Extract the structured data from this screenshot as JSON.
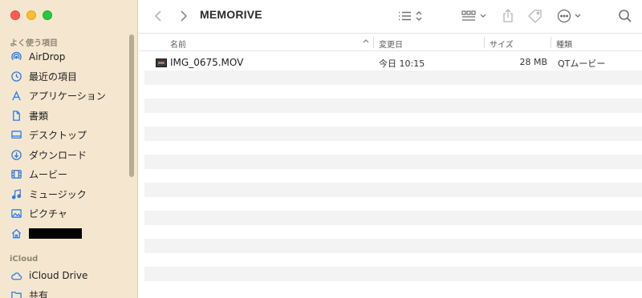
{
  "window": {
    "title": "MEMORIVE"
  },
  "sidebar": {
    "favorites_title": "よく使う項目",
    "favorites": [
      {
        "label": "AirDrop",
        "icon": "airdrop-icon"
      },
      {
        "label": "最近の項目",
        "icon": "clock-icon"
      },
      {
        "label": "アプリケーション",
        "icon": "applications-icon"
      },
      {
        "label": "書類",
        "icon": "document-icon"
      },
      {
        "label": "デスクトップ",
        "icon": "desktop-icon"
      },
      {
        "label": "ダウンロード",
        "icon": "download-icon"
      },
      {
        "label": "ムービー",
        "icon": "movie-icon"
      },
      {
        "label": "ミュージック",
        "icon": "music-icon"
      },
      {
        "label": "ピクチャ",
        "icon": "pictures-icon"
      },
      {
        "label": "",
        "icon": "home-icon",
        "redacted": true
      }
    ],
    "icloud_title": "iCloud",
    "icloud": [
      {
        "label": "iCloud Drive",
        "icon": "cloud-icon"
      },
      {
        "label": "共有",
        "icon": "shared-folder-icon"
      }
    ]
  },
  "columns": {
    "name": "名前",
    "modified": "変更日",
    "size": "サイズ",
    "kind": "種類"
  },
  "files": [
    {
      "name": "IMG_0675.MOV",
      "modified": "今日 10:15",
      "size": "28 MB",
      "kind": "QTムービー"
    }
  ],
  "colors": {
    "sidebar_bg": "#f5e7cf",
    "accent": "#2b7de9",
    "stripe": "#f3f3f3"
  }
}
